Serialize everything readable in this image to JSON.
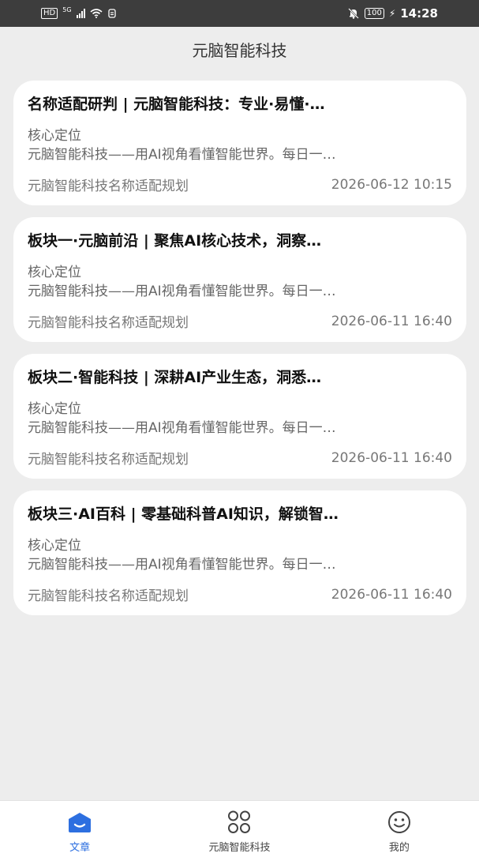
{
  "status_bar": {
    "hd": "HD",
    "network": "5G",
    "battery": "100",
    "time": "14:28"
  },
  "header": {
    "title": "元脑智能科技"
  },
  "articles": [
    {
      "title": "名称适配研判 | 元脑智能科技：专业·易懂·…",
      "subtitle": "核心定位",
      "summary": "元脑智能科技——用AI视角看懂智能世界。每日一…",
      "source": "元脑智能科技名称适配规划",
      "time": "2026-06-12 10:15"
    },
    {
      "title": "板块一·元脑前沿 | 聚焦AI核心技术，洞察…",
      "subtitle": "核心定位",
      "summary": "元脑智能科技——用AI视角看懂智能世界。每日一…",
      "source": "元脑智能科技名称适配规划",
      "time": "2026-06-11 16:40"
    },
    {
      "title": "板块二·智能科技 | 深耕AI产业生态，洞悉…",
      "subtitle": "核心定位",
      "summary": "元脑智能科技——用AI视角看懂智能世界。每日一…",
      "source": "元脑智能科技名称适配规划",
      "time": "2026-06-11 16:40"
    },
    {
      "title": "板块三·AI百科 | 零基础科普AI知识，解锁智…",
      "subtitle": "核心定位",
      "summary": "元脑智能科技——用AI视角看懂智能世界。每日一…",
      "source": "元脑智能科技名称适配规划",
      "time": "2026-06-11 16:40"
    }
  ],
  "tabbar": {
    "tabs": [
      {
        "label": "文章",
        "icon": "article-icon",
        "active": true
      },
      {
        "label": "元脑智能科技",
        "icon": "apps-icon",
        "active": false
      },
      {
        "label": "我的",
        "icon": "smile-icon",
        "active": false
      }
    ]
  },
  "colors": {
    "accent": "#2d6fe0",
    "background": "#ededed",
    "status_bar": "#3d3d3d"
  }
}
